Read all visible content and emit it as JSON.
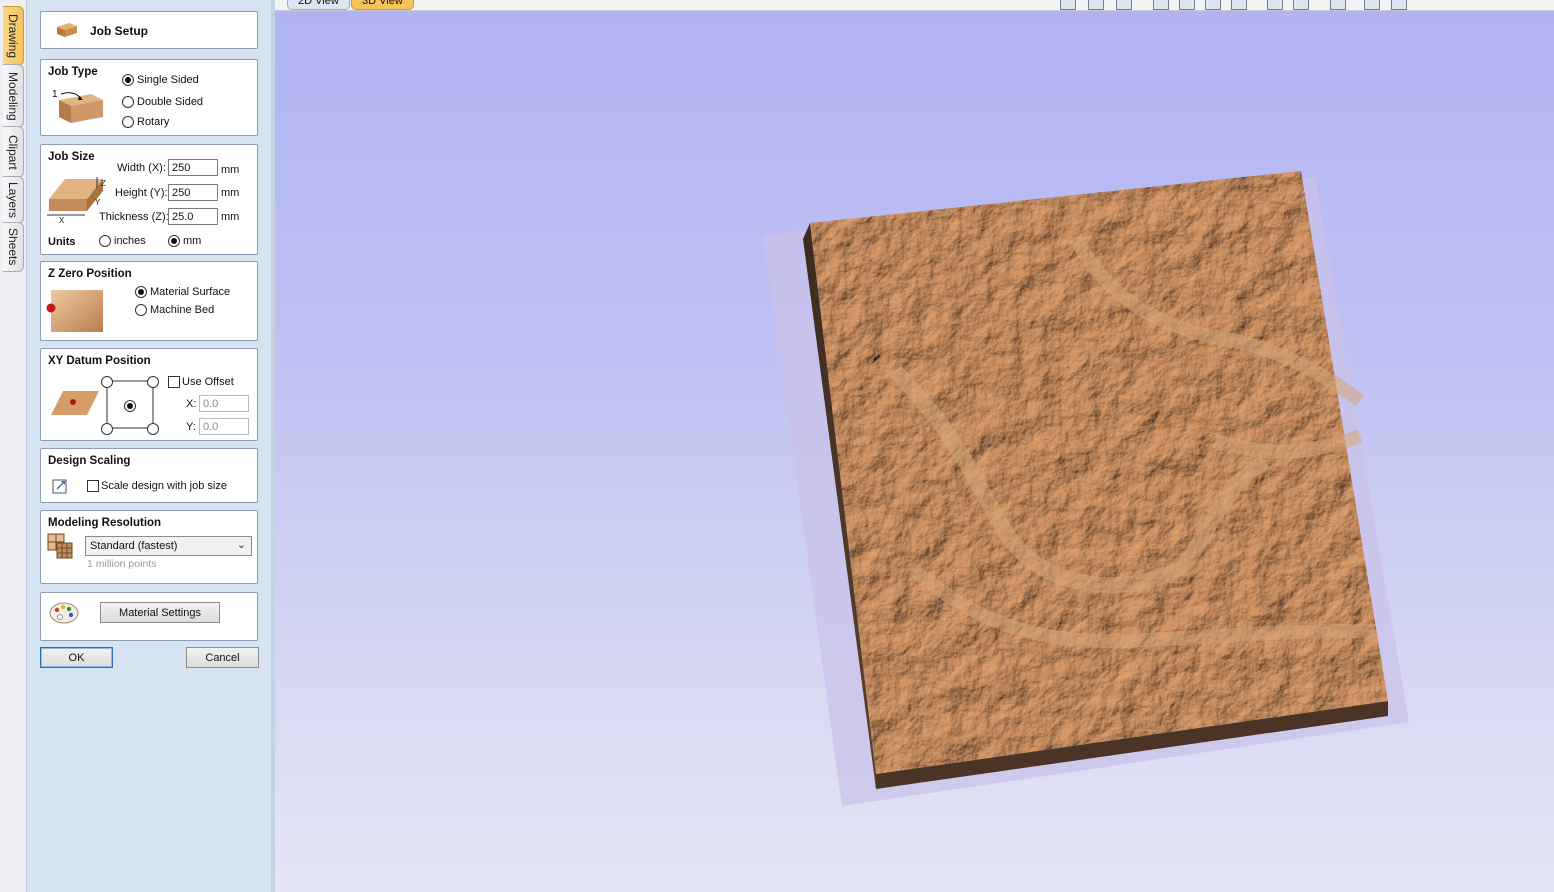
{
  "side_tabs": [
    "Drawing",
    "Modeling",
    "Clipart",
    "Layers",
    "Sheets"
  ],
  "view_tabs": [
    "2D View",
    "3D View"
  ],
  "header": {
    "title": "Job Setup"
  },
  "job_type": {
    "title": "Job Type",
    "step_label": "1",
    "options": [
      "Single Sided",
      "Double Sided",
      "Rotary"
    ],
    "selected": "Single Sided"
  },
  "job_size": {
    "title": "Job Size",
    "width_label": "Width (X):",
    "width_value": "250",
    "height_label": "Height (Y):",
    "height_value": "250",
    "thickness_label": "Thickness (Z):",
    "thickness_value": "25.0",
    "unit": "mm",
    "axis_z": "Z",
    "axis_y": "Y",
    "axis_x": "X",
    "units_label": "Units",
    "unit_options": [
      "inches",
      "mm"
    ],
    "selected_unit": "mm"
  },
  "z_zero": {
    "title": "Z Zero Position",
    "options": [
      "Material Surface",
      "Machine Bed"
    ],
    "selected": "Material Surface"
  },
  "xy_datum": {
    "title": "XY Datum Position",
    "use_offset_label": "Use Offset",
    "use_offset": false,
    "x_label": "X:",
    "x_value": "0.0",
    "y_label": "Y:",
    "y_value": "0.0"
  },
  "design_scaling": {
    "title": "Design Scaling",
    "scale_label": "Scale design with job size",
    "checked": false
  },
  "modeling_resolution": {
    "title": "Modeling Resolution",
    "selected": "Standard (fastest)",
    "hint": "1 million points"
  },
  "material": {
    "button_label": "Material Settings"
  },
  "actions": {
    "ok": "OK",
    "cancel": "Cancel"
  },
  "colors": {
    "panel_bg": "#d6e4f2",
    "viewport_top": "#b1b3f3",
    "viewport_bottom": "#e4e5f4",
    "active_tab": "#f5c35c",
    "material_wood": "#c08a5e"
  }
}
